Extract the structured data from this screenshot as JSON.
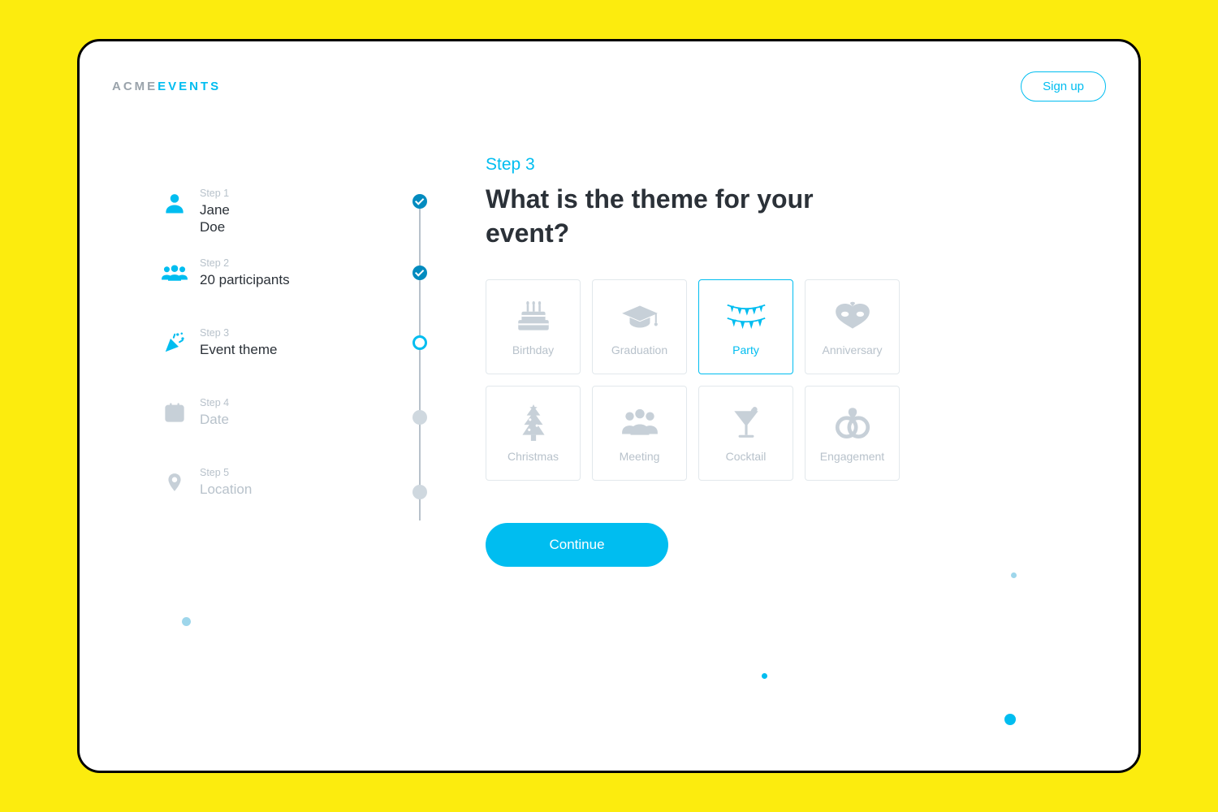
{
  "brand": {
    "part1": "ACME",
    "part2": "EVENTS"
  },
  "signup_label": "Sign up",
  "progress": {
    "step1": {
      "label": "Step 1",
      "value": "Jane\nDoe"
    },
    "step2": {
      "label": "Step 2",
      "value": "20 participants"
    },
    "step3": {
      "label": "Step 3",
      "value": "Event theme"
    },
    "step4": {
      "label": "Step 4",
      "value": "Date"
    },
    "step5": {
      "label": "Step 5",
      "value": "Location"
    }
  },
  "main": {
    "step_indicator": "Step 3",
    "question": "What is the theme for your event?",
    "continue_label": "Continue"
  },
  "themes": {
    "birthday": "Birthday",
    "graduation": "Graduation",
    "party": "Party",
    "anniversary": "Anniversary",
    "christmas": "Christmas",
    "meeting": "Meeting",
    "cocktail": "Cocktail",
    "engagement": "Engagement"
  },
  "selected_theme": "party"
}
